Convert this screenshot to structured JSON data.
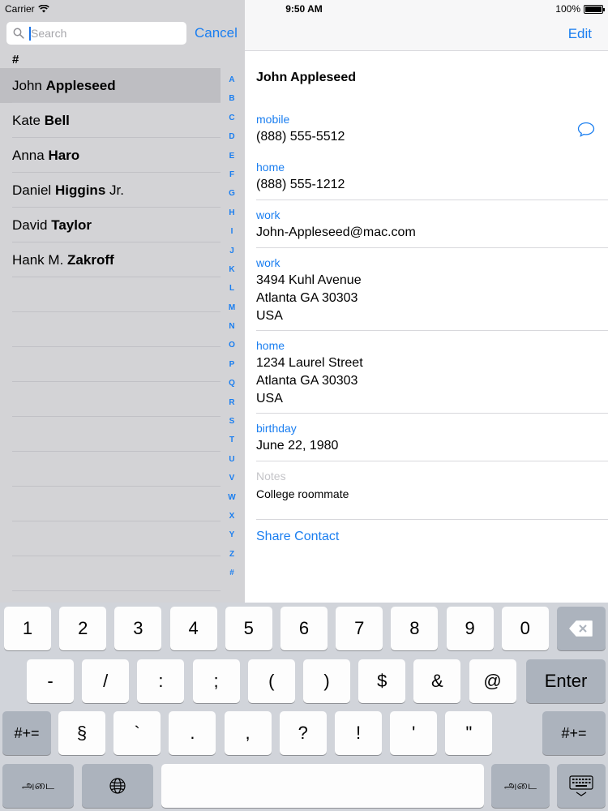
{
  "status_bar": {
    "carrier": "Carrier",
    "time": "9:50 AM",
    "battery": "100%"
  },
  "search": {
    "placeholder": "Search",
    "cancel_label": "Cancel"
  },
  "contact_list": {
    "section_header": "#",
    "contacts": [
      {
        "first": "John",
        "last": "Appleseed",
        "suffix": "",
        "selected": true
      },
      {
        "first": "Kate",
        "last": "Bell",
        "suffix": ""
      },
      {
        "first": "Anna",
        "last": "Haro",
        "suffix": ""
      },
      {
        "first": "Daniel",
        "last": "Higgins",
        "suffix": "Jr."
      },
      {
        "first": "David",
        "last": "Taylor",
        "suffix": ""
      },
      {
        "first": "Hank M.",
        "last": "Zakroff",
        "suffix": ""
      }
    ],
    "index": [
      "A",
      "B",
      "C",
      "D",
      "E",
      "F",
      "G",
      "H",
      "I",
      "J",
      "K",
      "L",
      "M",
      "N",
      "O",
      "P",
      "Q",
      "R",
      "S",
      "T",
      "U",
      "V",
      "W",
      "X",
      "Y",
      "Z",
      "#"
    ]
  },
  "detail": {
    "edit_label": "Edit",
    "name": "John Appleseed",
    "mobile": {
      "label": "mobile",
      "value": "(888) 555-5512"
    },
    "home_phone": {
      "label": "home",
      "value": "(888) 555-1212"
    },
    "work_email": {
      "label": "work",
      "value": "John-Appleseed@mac.com"
    },
    "work_address": {
      "label": "work",
      "line1": "3494 Kuhl Avenue",
      "line2": "Atlanta GA 30303",
      "line3": "USA"
    },
    "home_address": {
      "label": "home",
      "line1": "1234 Laurel Street",
      "line2": "Atlanta GA 30303",
      "line3": "USA"
    },
    "birthday": {
      "label": "birthday",
      "value": "June 22, 1980"
    },
    "notes": {
      "label": "Notes",
      "value": "College roommate"
    },
    "share_label": "Share Contact"
  },
  "keyboard": {
    "row1": [
      "1",
      "2",
      "3",
      "4",
      "5",
      "6",
      "7",
      "8",
      "9",
      "0"
    ],
    "row2": [
      "-",
      "/",
      ":",
      ";",
      "(",
      ")",
      "$",
      "&",
      "@"
    ],
    "enter_label": "Enter",
    "row3": [
      "§",
      "`",
      ".",
      ",",
      "?",
      "!",
      "'",
      "\""
    ],
    "shift_label": "#+=",
    "lang_label": "அடை"
  },
  "colors": {
    "accent": "#1a7ef0",
    "list_bg": "#d3d3d6",
    "keyboard_bg": "#d1d4da"
  }
}
